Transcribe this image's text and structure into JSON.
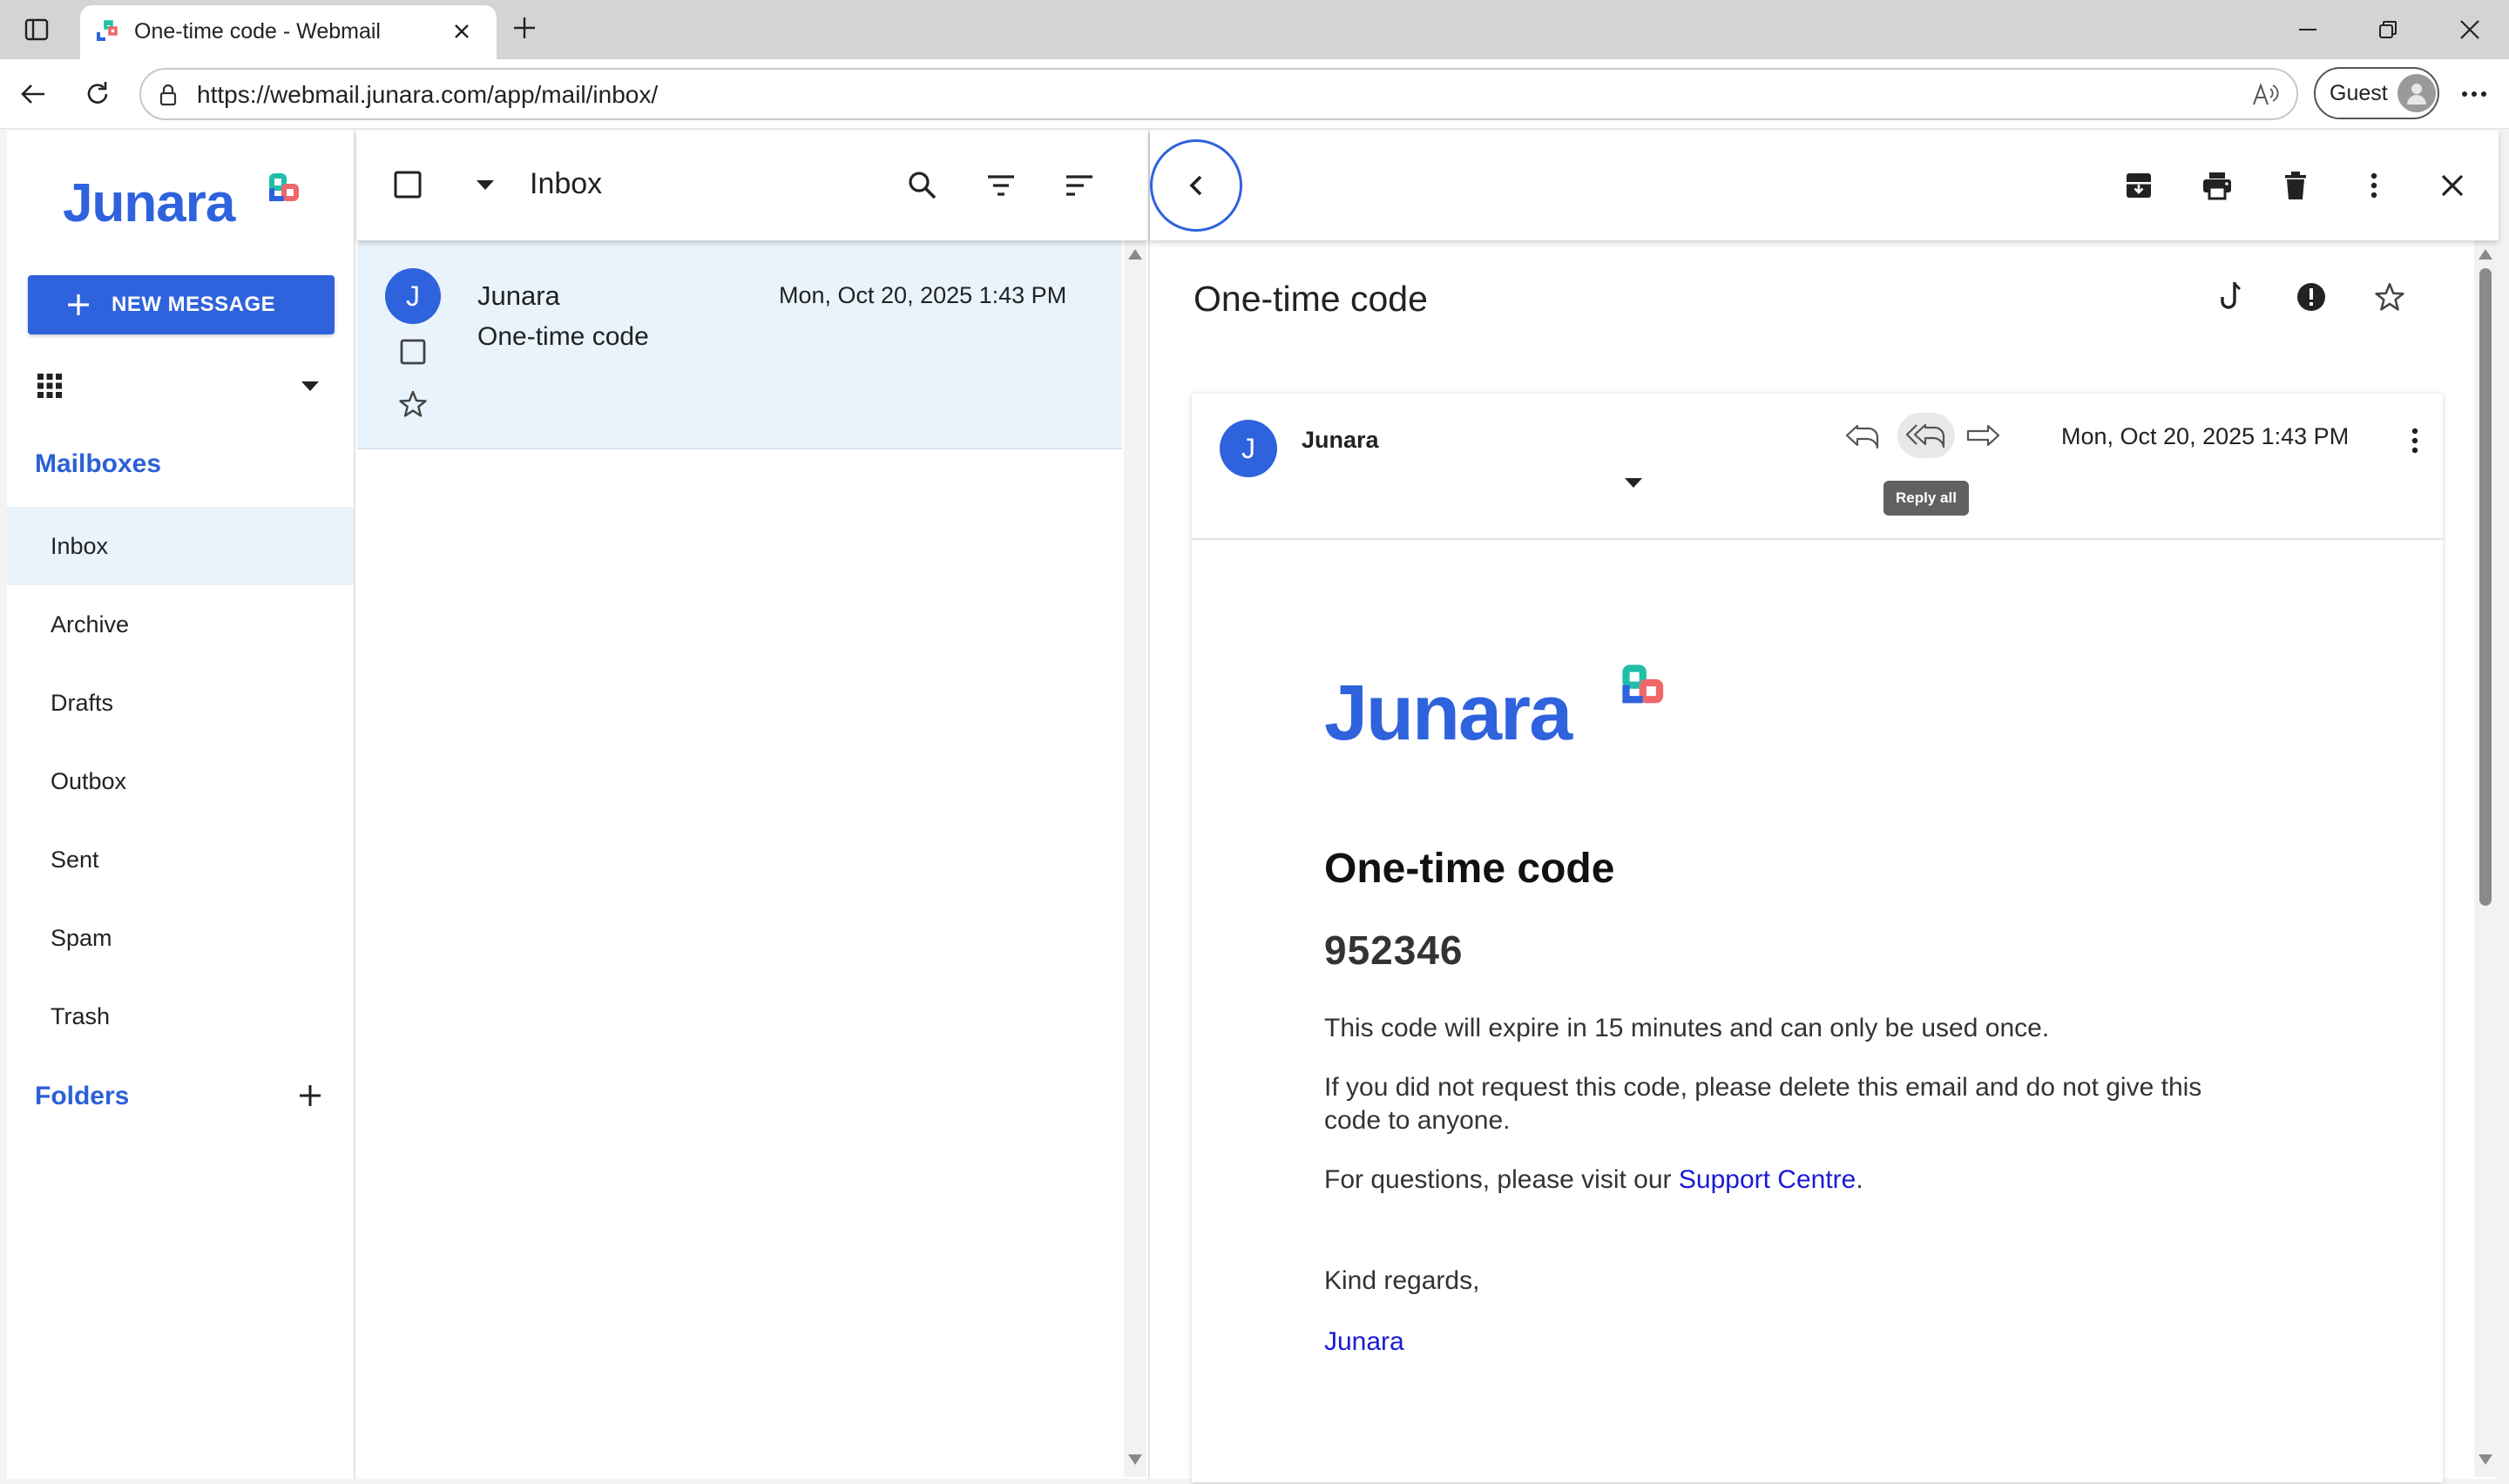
{
  "browser": {
    "tab_title": "One-time code - Webmail",
    "url": "https://webmail.junara.com/app/mail/inbox/",
    "profile_label": "Guest"
  },
  "brand": {
    "name": "Junara",
    "color": "#2f62dd",
    "accent_teal": "#1fbfa8",
    "accent_red": "#f0676a"
  },
  "sidebar": {
    "new_message_label": "NEW MESSAGE",
    "mailboxes_header": "Mailboxes",
    "mailboxes": [
      {
        "label": "Inbox",
        "active": true
      },
      {
        "label": "Archive"
      },
      {
        "label": "Drafts"
      },
      {
        "label": "Outbox"
      },
      {
        "label": "Sent"
      },
      {
        "label": "Spam"
      },
      {
        "label": "Trash"
      }
    ],
    "folders_header": "Folders"
  },
  "list": {
    "folder_title": "Inbox",
    "messages": [
      {
        "avatar_letter": "J",
        "sender": "Junara",
        "subject": "One-time code",
        "date": "Mon, Oct 20, 2025 1:43 PM"
      }
    ]
  },
  "reader": {
    "subject": "One-time code",
    "sender_avatar": "J",
    "sender": "Junara",
    "date": "Mon, Oct 20, 2025 1:43 PM",
    "tooltip": "Reply all",
    "email": {
      "heading": "One-time code",
      "code": "952346",
      "para1": "This code will expire in 15 minutes and can only be used once.",
      "para2_line1": "If you did not request this code, please delete this email and do not give this",
      "para2_line2": "code to anyone.",
      "para3_prefix": "For questions, please visit our ",
      "para3_link": "Support Centre",
      "para3_suffix": ".",
      "closing": "Kind regards,",
      "signature": "Junara"
    }
  }
}
